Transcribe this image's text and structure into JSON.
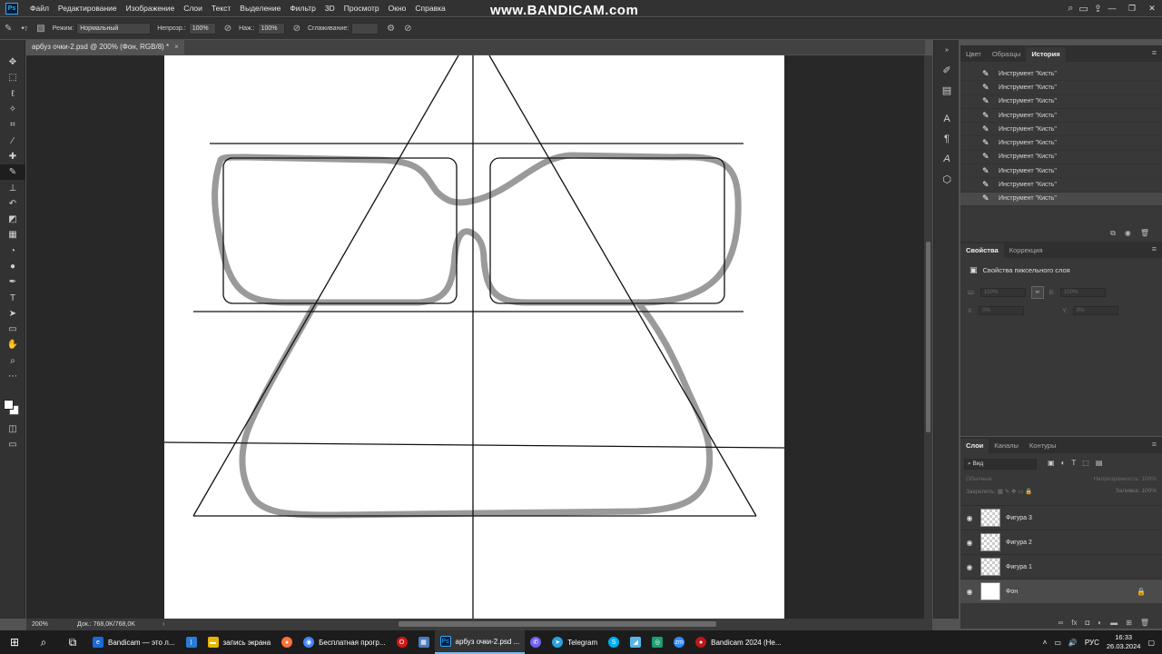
{
  "menu": {
    "logo": "Ps",
    "items": [
      "Файл",
      "Редактирование",
      "Изображение",
      "Слои",
      "Текст",
      "Выделение",
      "Фильтр",
      "3D",
      "Просмотр",
      "Окно",
      "Справка"
    ]
  },
  "watermark": "www.BANDICAM.com",
  "options": {
    "mode_label": "Режим:",
    "mode_value": "Нормальный",
    "opacity_label": "Непрозр.:",
    "opacity_value": "100%",
    "pressure_label": "Наж.:",
    "pressure_value": "100%",
    "smoothing_label": "Сглаживание:",
    "brush_size": "7"
  },
  "document": {
    "tab_title": "арбуз очки-2.psd @ 200% (Фон, RGB/8) *",
    "zoom": "200%",
    "doc_info": "Док.: 768,0K/768,0K"
  },
  "history": {
    "tabs": [
      "Цвет",
      "Образцы",
      "История"
    ],
    "active_tab": "История",
    "items": [
      "Инструмент \"Кисть\"",
      "Инструмент \"Кисть\"",
      "Инструмент \"Кисть\"",
      "Инструмент \"Кисть\"",
      "Инструмент \"Кисть\"",
      "Инструмент \"Кисть\"",
      "Инструмент \"Кисть\"",
      "Инструмент \"Кисть\"",
      "Инструмент \"Кисть\"",
      "Инструмент \"Кисть\"",
      "Инструмент \"Кисть\""
    ]
  },
  "properties": {
    "tabs": [
      "Свойства",
      "Коррекция"
    ],
    "title": "Свойства пиксельного слоя",
    "w_label": "Ш:",
    "w_value": "100%",
    "h_label": "В:",
    "h_value": "100%",
    "x_label": "X:",
    "x_value": "0%",
    "y_label": "Y:",
    "y_value": "0%"
  },
  "layers": {
    "tabs": [
      "Слои",
      "Каналы",
      "Контуры"
    ],
    "filter_value": "Вид",
    "blend_mode": "Обычные",
    "opacity_label": "Непрозрачность:",
    "opacity_value": "100%",
    "lock_label": "Закрепить:",
    "fill_label": "Заливка:",
    "fill_value": "100%",
    "items": [
      {
        "name": "Фигура 3",
        "selected": false
      },
      {
        "name": "Фигура 2",
        "selected": false
      },
      {
        "name": "Фигура 1",
        "selected": false
      },
      {
        "name": "Фон",
        "selected": true
      }
    ]
  },
  "taskbar": {
    "apps": [
      {
        "label": "Bandicam — это л...",
        "color": "#1c6ad6",
        "active": false
      },
      {
        "label": "",
        "color": "#2b7bd4",
        "active": false
      },
      {
        "label": "запись экрана",
        "color": "#e8b400",
        "active": false
      },
      {
        "label": "",
        "color": "#ff7139",
        "active": false
      },
      {
        "label": "Бесплатная прогр...",
        "color": "#4285f4",
        "active": false
      },
      {
        "label": "",
        "color": "#d11a1a",
        "active": false
      },
      {
        "label": "",
        "color": "#4a7abf",
        "active": false
      },
      {
        "label": "арбуз очки-2.psd ...",
        "color": "#001e36",
        "active": true
      },
      {
        "label": "",
        "color": "#7360f2",
        "active": false
      },
      {
        "label": "Telegram",
        "color": "#2aa3e0",
        "active": false
      },
      {
        "label": "",
        "color": "#00aff0",
        "active": false
      },
      {
        "label": "",
        "color": "#5ab6e8",
        "active": false
      },
      {
        "label": "",
        "color": "#1a9e75",
        "active": false
      },
      {
        "label": "",
        "color": "#2d8cff",
        "active": false
      },
      {
        "label": "Bandicam 2024 (Не...",
        "color": "#c0161a",
        "active": false
      }
    ],
    "lang": "РУС",
    "time": "16:33",
    "date": "26.03.2024"
  }
}
